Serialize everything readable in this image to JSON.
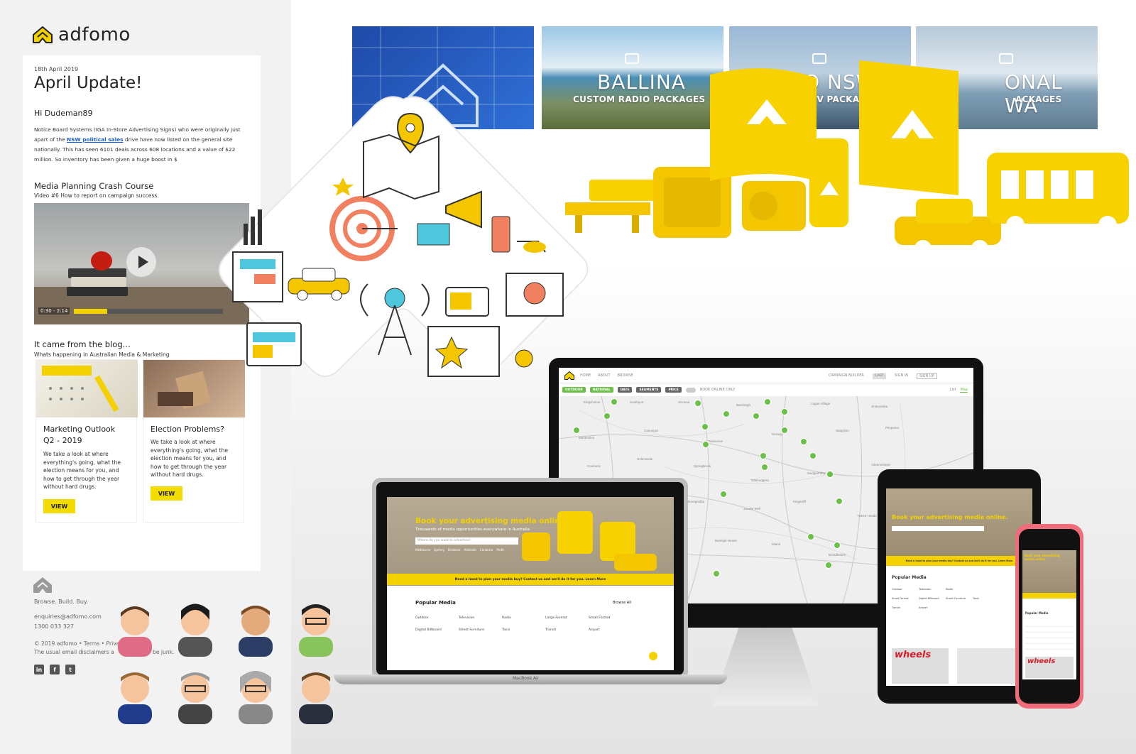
{
  "email": {
    "logo_text": "adfomo",
    "date": "18th April 2019",
    "title": "April Update!",
    "greeting": "Hi Dudeman89",
    "paragraph_before_link": "Notice Board Systems (IGA In-Store Advertising Signs) who were originally just apart of the ",
    "paragraph_link": "NSW political sales",
    "paragraph_after_link": " drive have now listed on the general site nationally. This has seen 6101 deals across 608 locations and a value of $22 million. So inventory has been given a huge boost in $",
    "course_heading": "Media Planning Crash Course",
    "course_sub": "Video #6 How to report on campaign success.",
    "video": {
      "time": "0:30 - 2:14",
      "progress": 0.22
    },
    "blog_heading": "It came from the blog...",
    "blog_sub": "Whats happening in Australian Media & Marketing",
    "posts": [
      {
        "title": "Marketing Outlook Q2 - 2019",
        "text": "We take a look at where everything's going, what the election means for you, and how to get through the year without hard drugs.",
        "button": "VIEW"
      },
      {
        "title": "Election Problems?",
        "text": "We take a look at where everything's going, what the election means for you, and how to get through the year without hard drugs.",
        "button": "VIEW"
      }
    ],
    "footer": {
      "tagline": "Browse. Build. Buy.",
      "email": "enquiries@adfomo.com",
      "phone": "1300 033 327",
      "copyright": "© 2019 adfomo  •  Terms  •  Priva",
      "disclaimer": "The usual email disclaimers a",
      "disclaimer_end": "be junk.",
      "social": [
        "linkedin-icon",
        "facebook-icon",
        "twitter-icon"
      ]
    }
  },
  "tiles": [
    {
      "city": "",
      "sub": "",
      "icon": "house-blueprint-icon"
    },
    {
      "city": "BALLINA",
      "sub": "CUSTOM RADIO PACKAGES",
      "icon": "radio-icon"
    },
    {
      "city": "O NSW",
      "sub": "TV PACKAGE",
      "icon": "tv-icon"
    },
    {
      "city": "ONAL WA",
      "sub": "ACKAGES",
      "icon": "radio-icon"
    }
  ],
  "imac": {
    "nav": [
      "HOME",
      "ABOUT",
      "BROWSE"
    ],
    "nav_right": [
      "CAMPAIGN BUILDER",
      "CART",
      "SIGN IN",
      "SIGN UP"
    ],
    "filters": [
      "OUTDOOR",
      "NATIONAL",
      "DATE",
      "SEGMENTS",
      "PRICE"
    ],
    "toggle_label": "BOOK ONLINE ONLY",
    "view_tabs": [
      "List",
      "Map"
    ],
    "places": [
      "Kingsholme",
      "Southport",
      "Ormeau",
      "Beenleigh",
      "Logan Village",
      "Jimboomba",
      "Mundoolun",
      "Canungra",
      "Tamborine",
      "Nerang",
      "Stapylton",
      "Pimpama",
      "Coomera",
      "Helensvale",
      "Springbrook",
      "Tallebudgera",
      "Mudgeeraba",
      "Advancetown",
      "Beaudesert",
      "Mount Tamborine",
      "Woongoolba",
      "Jacobs Well",
      "Kingscliff",
      "Tweed Heads",
      "Currumbin",
      "Palm Beach",
      "Burleigh Heads",
      "Miami",
      "Broadbeach",
      "Surfers Paradise",
      "Main Beach"
    ],
    "brand_label": ""
  },
  "macbook": {
    "label": "MacBook Air",
    "hero": "Book your advertising media online.",
    "hero_sub": "Thousands of media opportunities everywhere in Australia",
    "search_placeholder": "Where do you want to advertise?",
    "cities": [
      "Melbourne",
      "Sydney",
      "Brisbane",
      "Adelaide",
      "Canberra",
      "Perth"
    ],
    "banner": "Need a hand to plan your media buy? Contact us and we'll do it for you. Learn More",
    "popular_heading": "Popular Media",
    "browse_all": "Browse All",
    "media": [
      "Outdoor",
      "Television",
      "Radio",
      "Large Format",
      "Small Format",
      "Digital Billboard",
      "Street Furniture",
      "Taxis",
      "Transit",
      "Airport"
    ]
  },
  "ipad": {
    "hero": "Book your advertising media online.",
    "banner": "Need a hand to plan your media buy? Contact us and we'll do it for you. Learn More",
    "popular_heading": "Popular Media",
    "media": [
      "Outdoor",
      "Television",
      "Radio",
      "Small Format",
      "Digital Billboard",
      "Street Furniture",
      "Taxis",
      "Transit",
      "Airport"
    ],
    "news": "wheels"
  },
  "iphone": {
    "hero": "Book your advertising media online.",
    "popular_heading": "Popular Media",
    "news": "wheels"
  },
  "colors": {
    "brand": "#f3d000",
    "link": "#1a5fd0",
    "green_marker": "#6cc04a"
  }
}
